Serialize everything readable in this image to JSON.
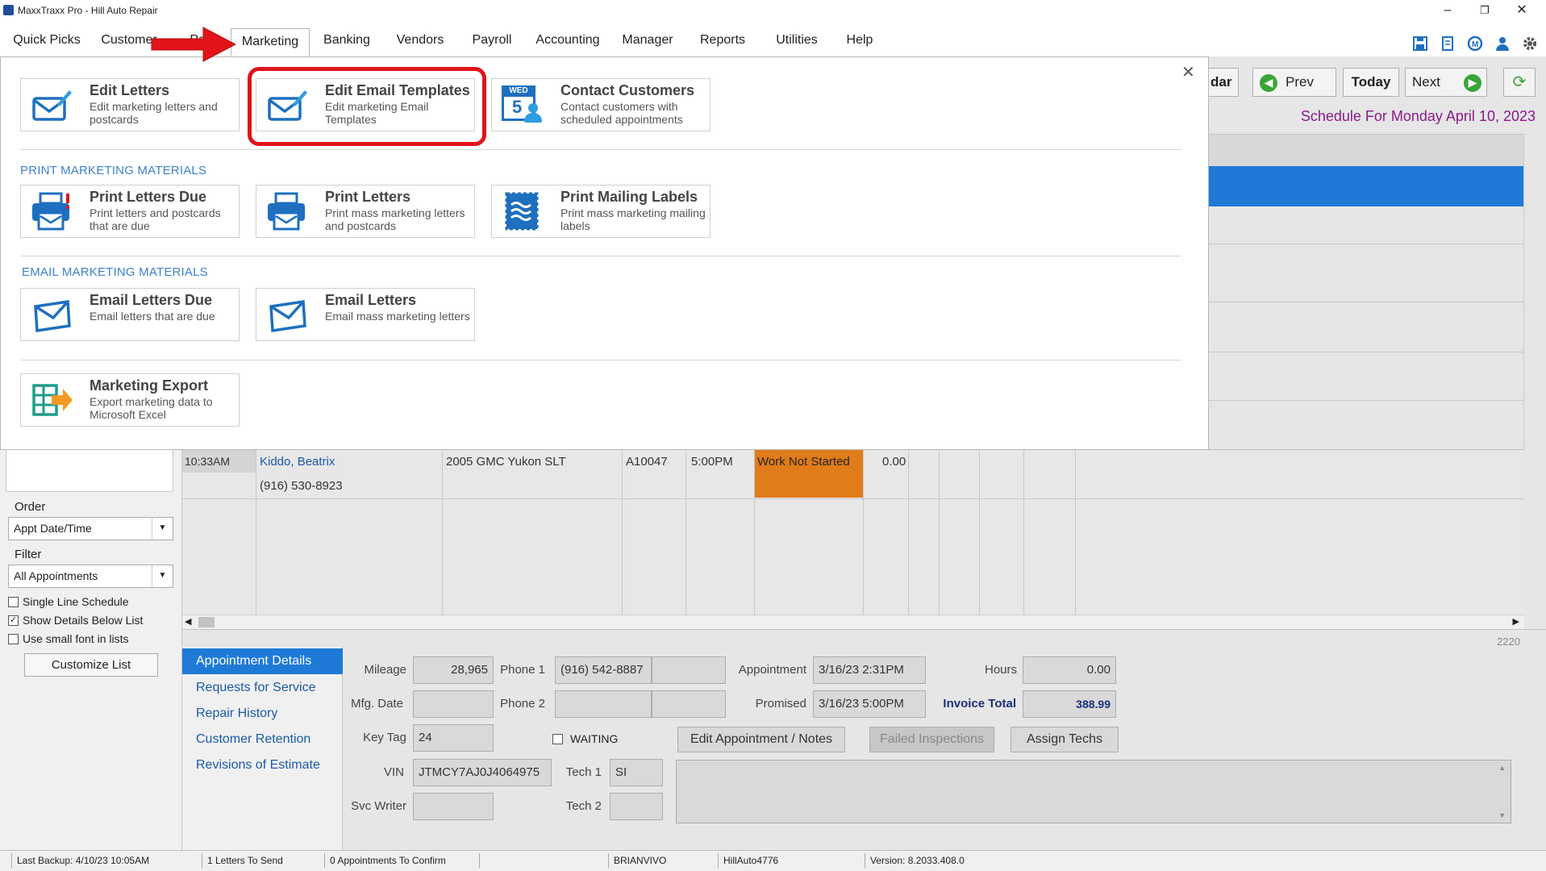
{
  "window": {
    "title": "MaxxTraxx Pro - Hill Auto Repair",
    "minimize": "–",
    "restore": "❐",
    "close": "✕"
  },
  "menu": [
    "Quick Picks",
    "Customer",
    "Parts",
    "Marketing",
    "Banking",
    "Vendors",
    "Payroll",
    "Accounting",
    "Manager",
    "Reports",
    "Utilities",
    "Help"
  ],
  "schedule": {
    "calendar_btn_partial": "dar",
    "prev": "Prev",
    "today": "Today",
    "next": "Next",
    "title": "Schedule For Monday April 10, 2023"
  },
  "marketing": {
    "close": "✕",
    "cards_top": [
      {
        "title": "Edit Letters",
        "desc": "Edit marketing letters and postcards",
        "icon": "envelope-pencil-icon"
      },
      {
        "title": "Edit Email Templates",
        "desc": "Edit marketing Email Templates",
        "icon": "envelope-pencil-icon"
      },
      {
        "title": "Contact Customers",
        "desc": "Contact customers with scheduled appointments",
        "icon": "calendar-person-icon",
        "cal_day": "WED",
        "cal_num": "5"
      }
    ],
    "print_section": "PRINT MARKETING MATERIALS",
    "cards_print": [
      {
        "title": "Print Letters Due",
        "desc": "Print letters and postcards that are due",
        "icon": "printer-alert-icon"
      },
      {
        "title": "Print Letters",
        "desc": "Print mass marketing letters and postcards",
        "icon": "printer-icon"
      },
      {
        "title": "Print Mailing Labels",
        "desc": "Print mass marketing mailing labels",
        "icon": "stamp-icon"
      }
    ],
    "email_section": "EMAIL MARKETING MATERIALS",
    "cards_email": [
      {
        "title": "Email Letters Due",
        "desc": "Email letters that are due",
        "icon": "envelope-icon"
      },
      {
        "title": "Email Letters",
        "desc": "Email mass marketing letters",
        "icon": "envelope-icon"
      }
    ],
    "export": {
      "title": "Marketing Export",
      "desc": "Export marketing data to Microsoft Excel",
      "icon": "excel-export-icon"
    }
  },
  "left": {
    "order_label": "Order",
    "order_value": "Appt Date/Time",
    "filter_label": "Filter",
    "filter_value": "All Appointments",
    "opt_single": "Single Line Schedule",
    "opt_details": "Show Details Below List",
    "opt_small": "Use small font in lists",
    "customize": "Customize List",
    "details_checked": true
  },
  "appointment_row": {
    "time": "10:33AM",
    "customer": "Kiddo, Beatrix",
    "phone": "(916) 530-8923",
    "vehicle": "2005 GMC  Yukon SLT",
    "ro": "A10047",
    "promised": "5:00PM",
    "status": "Work Not Started",
    "amount": "0.00",
    "status_color": "#e17c1a"
  },
  "detail_nav": [
    "Appointment Details",
    "Requests for Service",
    "Repair History",
    "Customer Retention",
    "Revisions of Estimate"
  ],
  "details": {
    "record_no": "2220",
    "mileage_label": "Mileage",
    "mileage": "28,965",
    "mfg_label": "Mfg. Date",
    "mfg": "",
    "keytag_label": "Key Tag",
    "keytag": "24",
    "vin_label": "VIN",
    "vin": "JTMCY7AJ0J4064975",
    "svcwriter_label": "Svc Writer",
    "svcwriter": "",
    "phone1_label": "Phone 1",
    "phone1": "(916) 542-8887",
    "phone2_label": "Phone 2",
    "phone2": "",
    "waiting_label": "WAITING",
    "tech1_label": "Tech 1",
    "tech1": "SI",
    "tech2_label": "Tech 2",
    "tech2": "",
    "appt_label": "Appointment",
    "appt": "3/16/23  2:31PM",
    "promised_label": "Promised",
    "promised": "3/16/23  5:00PM",
    "hours_label": "Hours",
    "hours": "0.00",
    "invoice_label": "Invoice Total",
    "invoice": "388.99",
    "btn_edit": "Edit Appointment / Notes",
    "btn_failed": "Failed Inspections",
    "btn_assign": "Assign Techs"
  },
  "status": {
    "backup": "Last Backup:  4/10/23  10:05AM",
    "letters": "1 Letters To Send",
    "confirm": "0 Appointments To Confirm",
    "blank": "",
    "user": "BRIANVIVO",
    "db": "HillAuto4776",
    "version": "Version:  8.2033.408.0"
  },
  "colors": {
    "accent": "#1e7ad6",
    "highlight": "#e0141a",
    "purple": "#8b1a8b",
    "section": "#3e82cc"
  }
}
